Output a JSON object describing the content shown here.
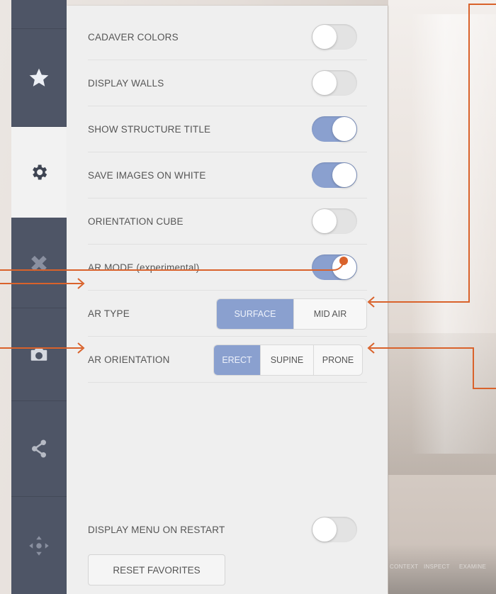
{
  "sidebar": {
    "items": [
      {
        "icon": "star-icon"
      },
      {
        "icon": "gear-icon",
        "active": true
      },
      {
        "icon": "pencil-ruler-icon"
      },
      {
        "icon": "camera-icon"
      },
      {
        "icon": "share-icon"
      },
      {
        "icon": "move-arrows-icon"
      }
    ]
  },
  "settings": {
    "cadaver_colors": {
      "label": "CADAVER COLORS",
      "on": false
    },
    "display_walls": {
      "label": "DISPLAY WALLS",
      "on": false
    },
    "show_structure_title": {
      "label": "SHOW STRUCTURE TITLE",
      "on": true
    },
    "save_images_on_white": {
      "label": "SAVE IMAGES ON WHITE",
      "on": true
    },
    "orientation_cube": {
      "label": "ORIENTATION CUBE",
      "on": false
    },
    "ar_mode": {
      "label": "AR MODE (experimental)",
      "on": true
    },
    "ar_type": {
      "label": "AR TYPE",
      "options": [
        "SURFACE",
        "MID AIR"
      ],
      "selected": "SURFACE"
    },
    "ar_orientation": {
      "label": "AR ORIENTATION",
      "options": [
        "ERECT",
        "SUPINE",
        "PRONE"
      ],
      "selected": "ERECT"
    },
    "display_menu_on_restart": {
      "label": "DISPLAY MENU ON RESTART",
      "on": false
    },
    "reset_favorites": {
      "label": "RESET FAVORITES"
    }
  },
  "background": {
    "bottom_bar_labels": [
      "CONTEXT",
      "INSPECT",
      "EXAMINE"
    ]
  },
  "colors": {
    "sidebar": "#4e5566",
    "accent": "#8aa0cf",
    "annotation": "#d9622b",
    "panel": "#efefef"
  }
}
